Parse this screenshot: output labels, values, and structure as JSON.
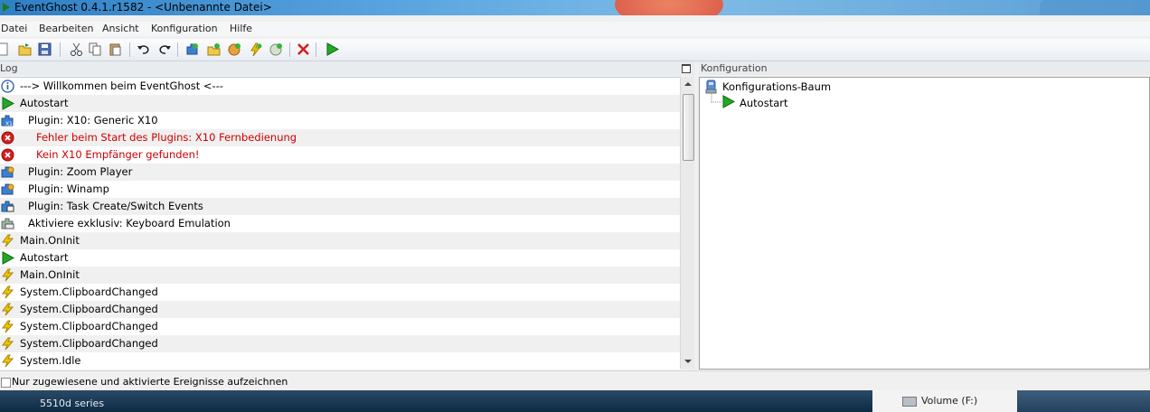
{
  "window": {
    "title": "EventGhost 0.4.1.r1582 - <Unbenannte Datei>"
  },
  "menu": [
    "Datei",
    "Bearbeiten",
    "Ansicht",
    "Konfiguration",
    "Hilfe"
  ],
  "toolbar": {
    "buttons": [
      "new-file",
      "open-folder",
      "save",
      "cut",
      "copy",
      "paste",
      "undo",
      "redo",
      "add-plugin",
      "add-folder",
      "add-macro",
      "add-event",
      "add-action",
      "delete",
      "execute"
    ]
  },
  "log": {
    "header": "Log",
    "rows": [
      {
        "icon": "info-icon",
        "text": "---> Willkommen beim EventGhost <---",
        "indent": 0,
        "error": false
      },
      {
        "icon": "play-icon",
        "text": "Autostart",
        "indent": 0,
        "error": false
      },
      {
        "icon": "plugin-x10-icon",
        "text": "Plugin: X10: Generic X10",
        "indent": 1,
        "error": false
      },
      {
        "icon": "error-icon",
        "text": "Fehler beim Start des Plugins: X10 Fernbedienung",
        "indent": 2,
        "error": true
      },
      {
        "icon": "error-icon",
        "text": "Kein X10 Empfänger gefunden!",
        "indent": 2,
        "error": true
      },
      {
        "icon": "plugin-icon",
        "text": "Plugin: Zoom Player",
        "indent": 1,
        "error": false
      },
      {
        "icon": "plugin-icon",
        "text": "Plugin: Winamp",
        "indent": 1,
        "error": false
      },
      {
        "icon": "plugin-task-icon",
        "text": "Plugin: Task Create/Switch Events",
        "indent": 1,
        "error": false
      },
      {
        "icon": "plugin-keyboard-icon",
        "text": "Aktiviere exklusiv: Keyboard Emulation",
        "indent": 1,
        "error": false
      },
      {
        "icon": "lightning-icon",
        "text": "Main.OnInit",
        "indent": 0,
        "error": false
      },
      {
        "icon": "play-icon",
        "text": "Autostart",
        "indent": 0,
        "error": false
      },
      {
        "icon": "lightning-icon",
        "text": "Main.OnInit",
        "indent": 0,
        "error": false
      },
      {
        "icon": "lightning-icon",
        "text": "System.ClipboardChanged",
        "indent": 0,
        "error": false
      },
      {
        "icon": "lightning-icon",
        "text": "System.ClipboardChanged",
        "indent": 0,
        "error": false
      },
      {
        "icon": "lightning-icon",
        "text": "System.ClipboardChanged",
        "indent": 0,
        "error": false
      },
      {
        "icon": "lightning-icon",
        "text": "System.ClipboardChanged",
        "indent": 0,
        "error": false
      },
      {
        "icon": "lightning-icon",
        "text": "System.Idle",
        "indent": 0,
        "error": false
      }
    ]
  },
  "config": {
    "header": "Konfiguration",
    "root": "Konfigurations-Baum",
    "children": [
      "Autostart"
    ]
  },
  "status": {
    "checkbox_label": "Nur zugewiesene und aktivierte Ereignisse aufzeichnen",
    "checked": false
  },
  "desktop": {
    "left_text": "5510d series",
    "right_text": "Volume (F:)"
  }
}
